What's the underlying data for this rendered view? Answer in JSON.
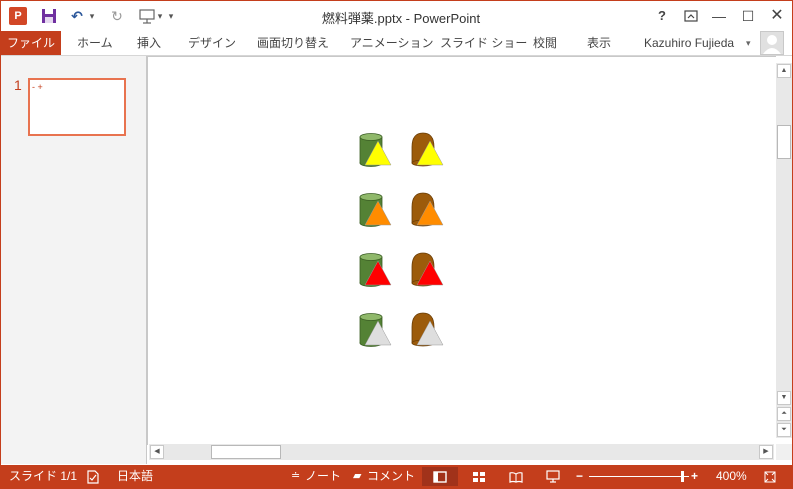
{
  "titlebar": {
    "app_icon": "P",
    "title": "燃料弾薬.pptx - PowerPoint",
    "icons": {
      "save": "save-icon",
      "undo": "undo-icon",
      "redo": "redo-icon",
      "present": "start-from-beginning-icon"
    }
  },
  "ribbon": {
    "file": "ファイル",
    "tabs": [
      "ホーム",
      "挿入",
      "デザイン",
      "画面切り替え",
      "アニメーション",
      "スライド ショー",
      "校閲",
      "表示"
    ],
    "user": "Kazuhiro Fujieda"
  },
  "thumbnails": {
    "slide_number": "1",
    "thumb_marks": "- +"
  },
  "slide": {
    "colors": {
      "cylinder": "#548235",
      "dome": "#9c5b0b",
      "triangle_yellow": "#ffff00",
      "triangle_orange": "#ff8c00",
      "triangle_red": "#ff0000",
      "triangle_white": "#dedede"
    },
    "rows": [
      {
        "cylinder_triangle": "#ffff00",
        "dome_triangle": "#ffff00"
      },
      {
        "cylinder_triangle": "#ff8c00",
        "dome_triangle": "#ff8c00"
      },
      {
        "cylinder_triangle": "#ff0000",
        "dome_triangle": "#ff0000"
      },
      {
        "cylinder_triangle": "#dedede",
        "dome_triangle": "#dedede"
      }
    ]
  },
  "statusbar": {
    "slide_info": "スライド 1/1",
    "language": "日本語",
    "notes": "ノート",
    "comments": "コメント",
    "zoom_level": "400%",
    "zoom_fraction": 0.94,
    "accent": "#c43e1c"
  }
}
